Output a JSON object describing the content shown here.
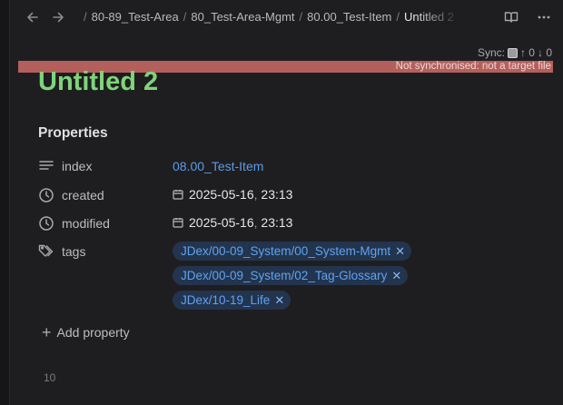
{
  "header": {
    "breadcrumbs": [
      {
        "label": "80-89_Test-Area"
      },
      {
        "label": "80_Test-Area-Mgmt"
      },
      {
        "label": "80.00_Test-Item"
      },
      {
        "label": "Untitled 2"
      }
    ],
    "icons": {
      "back": "arrow-left-icon",
      "forward": "arrow-right-icon",
      "reading_mode": "book-open-icon",
      "more": "more-options-icon"
    }
  },
  "sync": {
    "label": "Sync:",
    "up": "↑ 0",
    "down": "↓ 0",
    "warning": "Not synchronised: not a target file",
    "warning_color": "#b3605d"
  },
  "note": {
    "title": "Untitled 2",
    "title_color": "#7fd47a"
  },
  "properties": {
    "heading": "Properties",
    "items": [
      {
        "key": "index",
        "icon": "text-lines-icon",
        "value": "08.00_Test-Item"
      },
      {
        "key": "created",
        "icon": "clock-icon",
        "date": "2025-05-16",
        "time": "23:13"
      },
      {
        "key": "modified",
        "icon": "clock-icon",
        "date": "2025-05-16",
        "time": "23:13"
      },
      {
        "key": "tags",
        "icon": "tags-icon"
      }
    ],
    "tags": [
      "JDex/00-09_System/00_System-Mgmt",
      "JDex/00-09_System/02_Tag-Glossary",
      "JDex/10-19_Life"
    ],
    "add_label": "Add property"
  },
  "editor": {
    "line_number": "10"
  },
  "colors": {
    "background": "#1e1e20",
    "link": "#5a9ce6",
    "tag_bg": "#23344e",
    "tag_text": "#5fa3f0"
  }
}
